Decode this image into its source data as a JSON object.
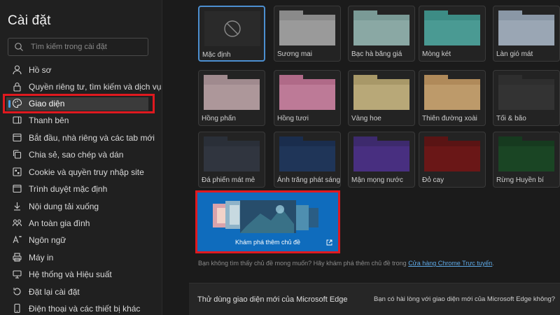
{
  "sidebar": {
    "title": "Cài đặt",
    "search_placeholder": "Tìm kiếm trong cài đặt",
    "items": [
      {
        "label": "Hồ sơ",
        "icon": "profile-icon"
      },
      {
        "label": "Quyền riêng tư, tìm kiếm và dịch vụ",
        "icon": "lock-icon"
      },
      {
        "label": "Giao diện",
        "icon": "palette-icon",
        "active": true
      },
      {
        "label": "Thanh bên",
        "icon": "sidebar-panel-icon"
      },
      {
        "label": "Bắt đầu, nhà riêng và các tab mới",
        "icon": "power-icon"
      },
      {
        "label": "Chia sẻ, sao chép và dán",
        "icon": "share-icon"
      },
      {
        "label": "Cookie và quyền truy nhập site",
        "icon": "cookie-icon"
      },
      {
        "label": "Trình duyệt mặc định",
        "icon": "browser-icon"
      },
      {
        "label": "Nội dung tải xuống",
        "icon": "download-icon"
      },
      {
        "label": "An toàn gia đình",
        "icon": "family-icon"
      },
      {
        "label": "Ngôn ngữ",
        "icon": "language-icon"
      },
      {
        "label": "Máy in",
        "icon": "printer-icon"
      },
      {
        "label": "Hệ thống và Hiệu suất",
        "icon": "system-icon"
      },
      {
        "label": "Đặt lại cài đặt",
        "icon": "reset-icon"
      },
      {
        "label": "Điện thoại và các thiết bị khác",
        "icon": "phone-icon"
      }
    ]
  },
  "themes": [
    {
      "name": "Mặc định",
      "selected": true,
      "color": "#2b2b2b",
      "body": "#2b2b2b"
    },
    {
      "name": "Sương mai",
      "color": "#8a8a8a",
      "body": "#9a9a9a"
    },
    {
      "name": "Bạc hà băng giá",
      "color": "#7a9a96",
      "body": "#8aa8a4"
    },
    {
      "name": "Mòng két",
      "color": "#3d8c85",
      "body": "#4a9a93"
    },
    {
      "name": "Làn gió mát",
      "color": "#8a97a6",
      "body": "#9aa6b4"
    },
    {
      "name": "Hồng phấn",
      "color": "#a08a8e",
      "body": "#ad979a"
    },
    {
      "name": "Hồng tươi",
      "color": "#b06a88",
      "body": "#bd7a97"
    },
    {
      "name": "Vàng hoe",
      "color": "#a89868",
      "body": "#b8a878"
    },
    {
      "name": "Thiên đường xoài",
      "color": "#b08a5a",
      "body": "#bd9a6a"
    },
    {
      "name": "Tối & bão",
      "color": "#2e2e2e",
      "body": "#333333"
    },
    {
      "name": "Đá phiến mát mẻ",
      "color": "#2a2f38",
      "body": "#30353f"
    },
    {
      "name": "Ánh trăng phát sáng",
      "color": "#1a2d4d",
      "body": "#1f3558"
    },
    {
      "name": "Mận mọng nước",
      "color": "#3d2a6d",
      "body": "#482f80"
    },
    {
      "name": "Đỏ cay",
      "color": "#5a1414",
      "body": "#6a1717"
    },
    {
      "name": "Rừng Huyền bí",
      "color": "#163a1f",
      "body": "#1a4524"
    }
  ],
  "explore": {
    "caption": "Khám phá thêm chủ đề",
    "icon": "external-link-icon",
    "accent": "#0f6cbd"
  },
  "hint": {
    "text": "Bạn không tìm thấy chủ đề mong muốn? Hãy khám phá thêm chủ đề trong ",
    "link": "Cửa hàng Chrome Trực tuyến",
    "after": "."
  },
  "try_new": {
    "title": "Thử dùng giao diện mới của Microsoft Edge",
    "question": "Bạn có hài lòng với giao diện mới của Microsoft Edge không?"
  },
  "colors": {
    "highlight_box": "#e0191f",
    "selected_theme_border": "#4c8fd0"
  }
}
